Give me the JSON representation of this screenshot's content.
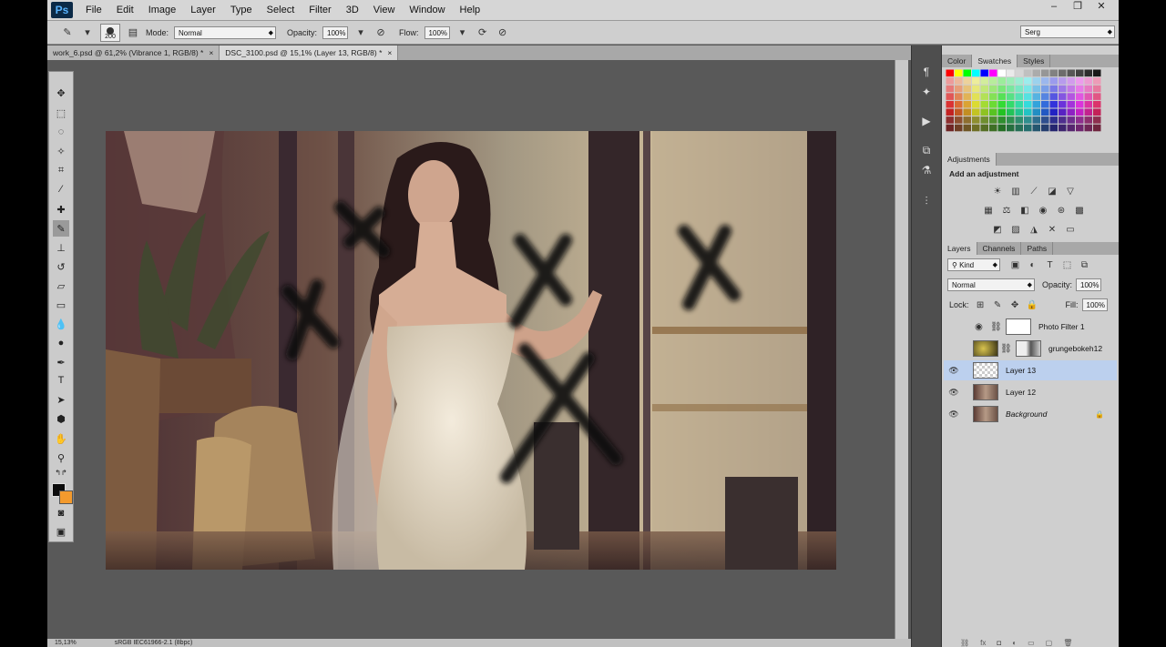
{
  "app": {
    "logo": "Ps"
  },
  "menu": [
    "File",
    "Edit",
    "Image",
    "Layer",
    "Type",
    "Select",
    "Filter",
    "3D",
    "View",
    "Window",
    "Help"
  ],
  "window_controls": {
    "minimize": "–",
    "restore": "❐",
    "close": "✕"
  },
  "options": {
    "brush_size": "200",
    "mode_label": "Mode:",
    "mode_value": "Normal",
    "opacity_label": "Opacity:",
    "opacity_value": "100%",
    "flow_label": "Flow:",
    "flow_value": "100%",
    "workspace": "Serg"
  },
  "tabs": [
    {
      "label": "work_6.psd @ 61,2% (Vibrance 1, RGB/8) *",
      "close": "×"
    },
    {
      "label": "DSC_3100.psd @ 15,1% (Layer 13, RGB/8) *",
      "close": "×"
    }
  ],
  "status": {
    "zoom": "15,13%",
    "profile": "sRGB IEC61966-2.1 (8bpc)"
  },
  "colors": {
    "foreground": "#0c0c0c",
    "background": "#f39a2d",
    "selection": "#bcd0ee"
  },
  "panels": {
    "color_tabs": [
      "Color",
      "Swatches",
      "Styles"
    ],
    "adjustments_tab": "Adjustments",
    "adjustments_title": "Add an adjustment",
    "layers_tabs": [
      "Layers",
      "Channels",
      "Paths"
    ],
    "kind": "Kind",
    "blend_mode": "Normal",
    "opacity_label": "Opacity:",
    "opacity_value": "100%",
    "lock_label": "Lock:",
    "fill_label": "Fill:",
    "fill_value": "100%"
  },
  "layers": [
    {
      "name": "Photo Filter 1",
      "visible": false
    },
    {
      "name": "grungebokeh12",
      "visible": false
    },
    {
      "name": "Layer 13",
      "visible": true,
      "selected": true
    },
    {
      "name": "Layer 12",
      "visible": true
    },
    {
      "name": "Background",
      "visible": true,
      "locked": true
    }
  ]
}
